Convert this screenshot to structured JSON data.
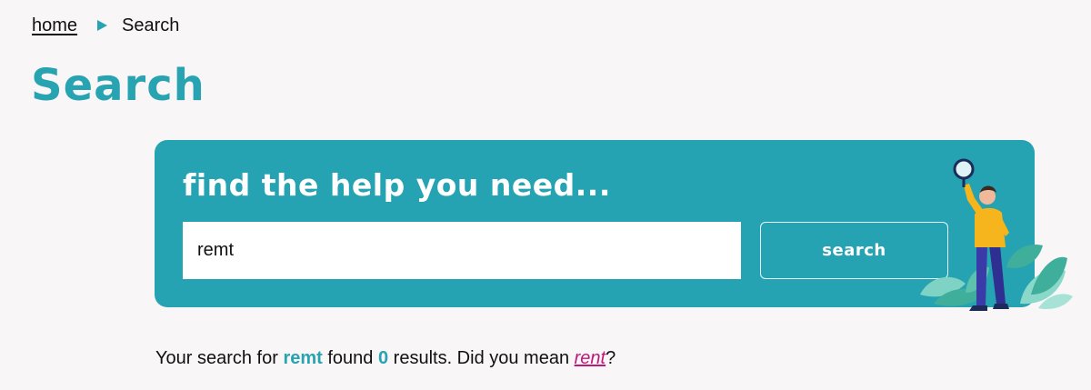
{
  "breadcrumb": {
    "home_label": "home",
    "current_label": "Search"
  },
  "page": {
    "title": "Search"
  },
  "search_panel": {
    "heading": "find the help you need...",
    "input_value": "remt",
    "button_label": "search"
  },
  "results": {
    "prefix": "Your search for ",
    "query": "remt",
    "middle": " found ",
    "count": "0",
    "suffix": " results. Did you mean ",
    "suggestion": "rent",
    "end": "?"
  },
  "colors": {
    "accent": "#27a3b2",
    "panel": "#26a3b2",
    "suggestion_link": "#c0187a",
    "background": "#f8f6f7"
  },
  "icons": [
    "breadcrumb-arrow-icon",
    "search-illustration"
  ]
}
